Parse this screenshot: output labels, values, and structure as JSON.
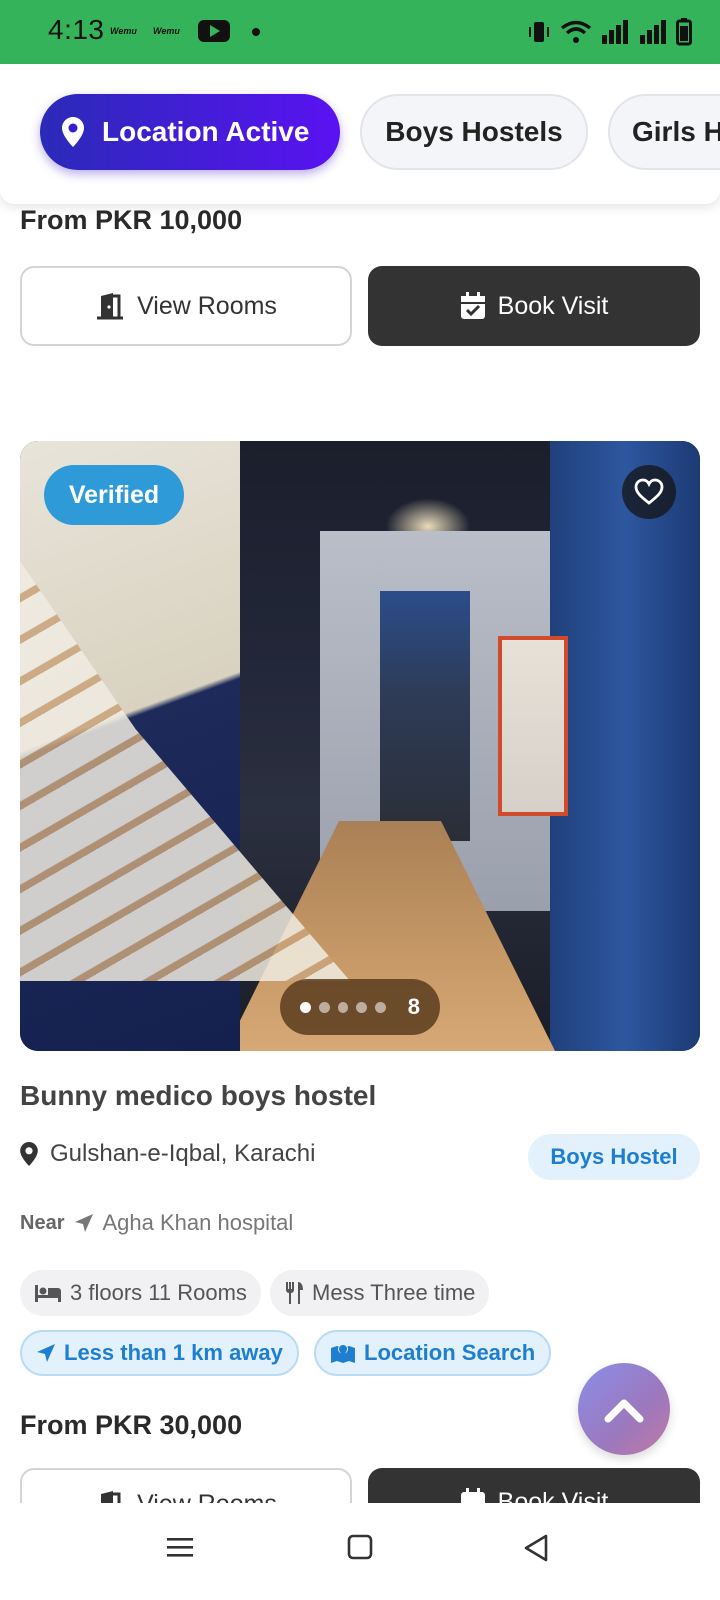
{
  "status_bar": {
    "time": "4:13",
    "badge_1": "Wemu",
    "badge_2": "Wemu"
  },
  "filters": {
    "active_label": "Location Active",
    "boys_label": "Boys Hostels",
    "girls_label": "Girls H"
  },
  "previous_listing": {
    "price": "From PKR 10,000",
    "view_rooms_label": "View Rooms",
    "book_visit_label": "Book Visit"
  },
  "listing": {
    "verified_label": "Verified",
    "photo_count": "8",
    "title": "Bunny medico boys hostel",
    "location": "Gulshan-e-Iqbal, Karachi",
    "type_badge": "Boys Hostel",
    "near_label": "Near",
    "near_place": "Agha Khan hospital",
    "features": {
      "rooms": "3 floors 11 Rooms",
      "mess": "Mess Three time",
      "distance": "Less than 1 km away",
      "location_search": "Location Search"
    },
    "price": "From PKR 30,000",
    "view_rooms_label": "View Rooms",
    "book_visit_label": "Book Visit"
  },
  "colors": {
    "status_bar": "#34b35a",
    "chip_gradient_start": "#2a2ab8",
    "chip_gradient_end": "#5a12f2",
    "dark_button": "#333333",
    "verified": "#2f9ad8",
    "accent_blue": "#1e7ed0"
  },
  "icons": [
    "map-pin-icon",
    "door-icon",
    "calendar-check-icon",
    "heart-icon",
    "bed-icon",
    "utensils-icon",
    "location-arrow-icon",
    "map-marked-icon",
    "chevron-up-icon",
    "menu-icon",
    "home-square-icon",
    "back-triangle-icon"
  ]
}
